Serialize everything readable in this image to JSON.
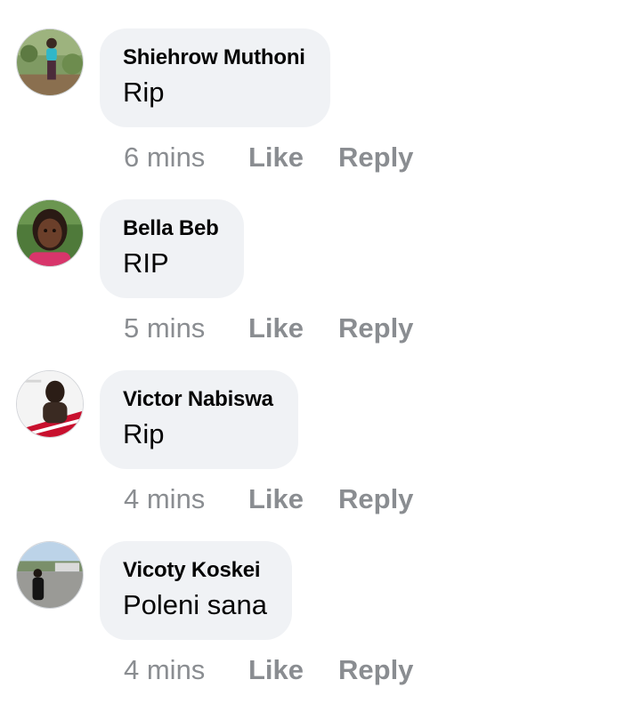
{
  "comments": [
    {
      "author": "Shiehrow Muthoni",
      "text": "Rip",
      "time": "6 mins",
      "like_label": "Like",
      "reply_label": "Reply"
    },
    {
      "author": "Bella Beb",
      "text": "RIP",
      "time": "5 mins",
      "like_label": "Like",
      "reply_label": "Reply"
    },
    {
      "author": "Victor Nabiswa",
      "text": "Rip",
      "time": "4 mins",
      "like_label": "Like",
      "reply_label": "Reply"
    },
    {
      "author": "Vicoty Koskei",
      "text": "Poleni sana",
      "time": "4 mins",
      "like_label": "Like",
      "reply_label": "Reply"
    }
  ],
  "colors": {
    "bubble": "#f0f2f5",
    "author_text": "#050505",
    "meta_text": "#8a8d91"
  }
}
